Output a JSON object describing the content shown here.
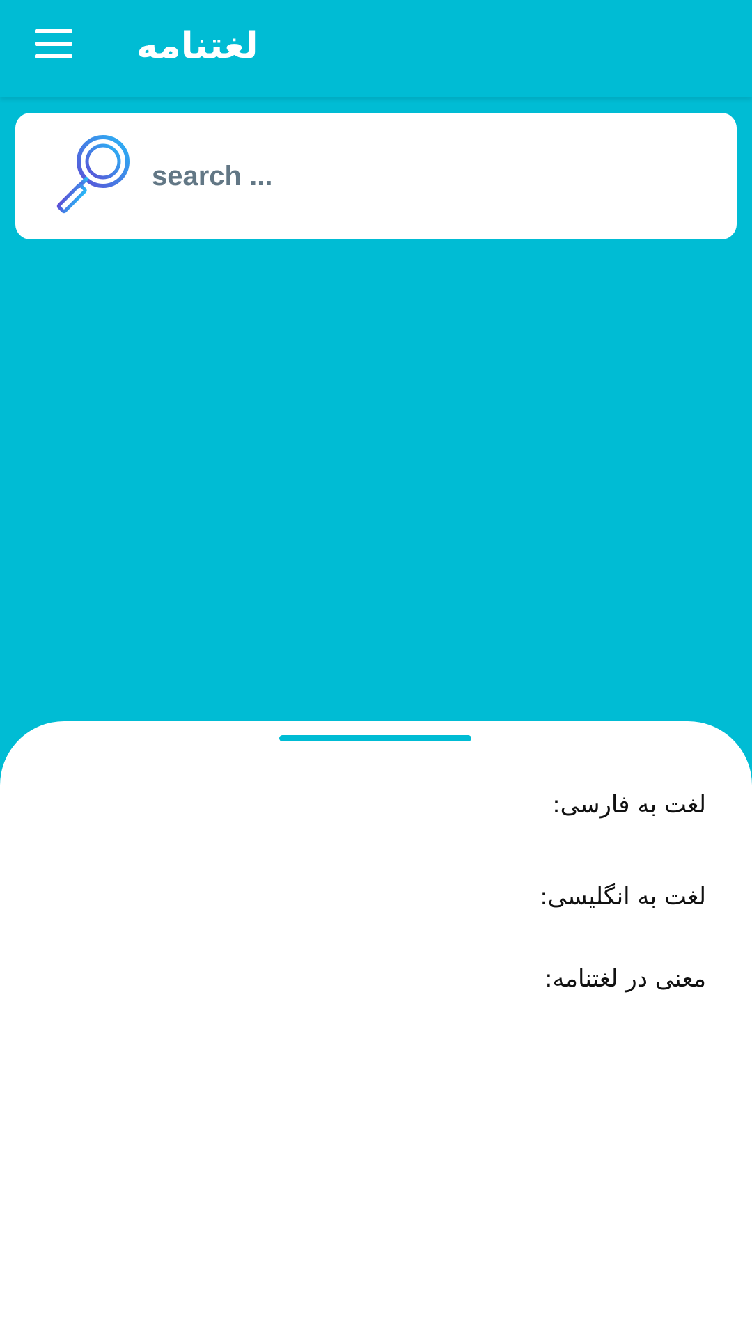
{
  "app_bar": {
    "title": "لغتنامه",
    "menu_icon": "hamburger-menu-icon",
    "background": "#00BCD4"
  },
  "search": {
    "placeholder": "search ...",
    "value": "",
    "icon": "magnifier-icon"
  },
  "result_sheet": {
    "persian_word_label": "لغت به فارسی:",
    "english_word_label": "لغت به انگلیسی:",
    "dictionary_meaning_label": "معنی در لغتنامه:"
  },
  "colors": {
    "primary": "#00BCD4",
    "card": "#FFFFFF",
    "placeholder_text": "#627785",
    "icon_gradient_start": "#29B6F6",
    "icon_gradient_end": "#5C4FD6"
  }
}
